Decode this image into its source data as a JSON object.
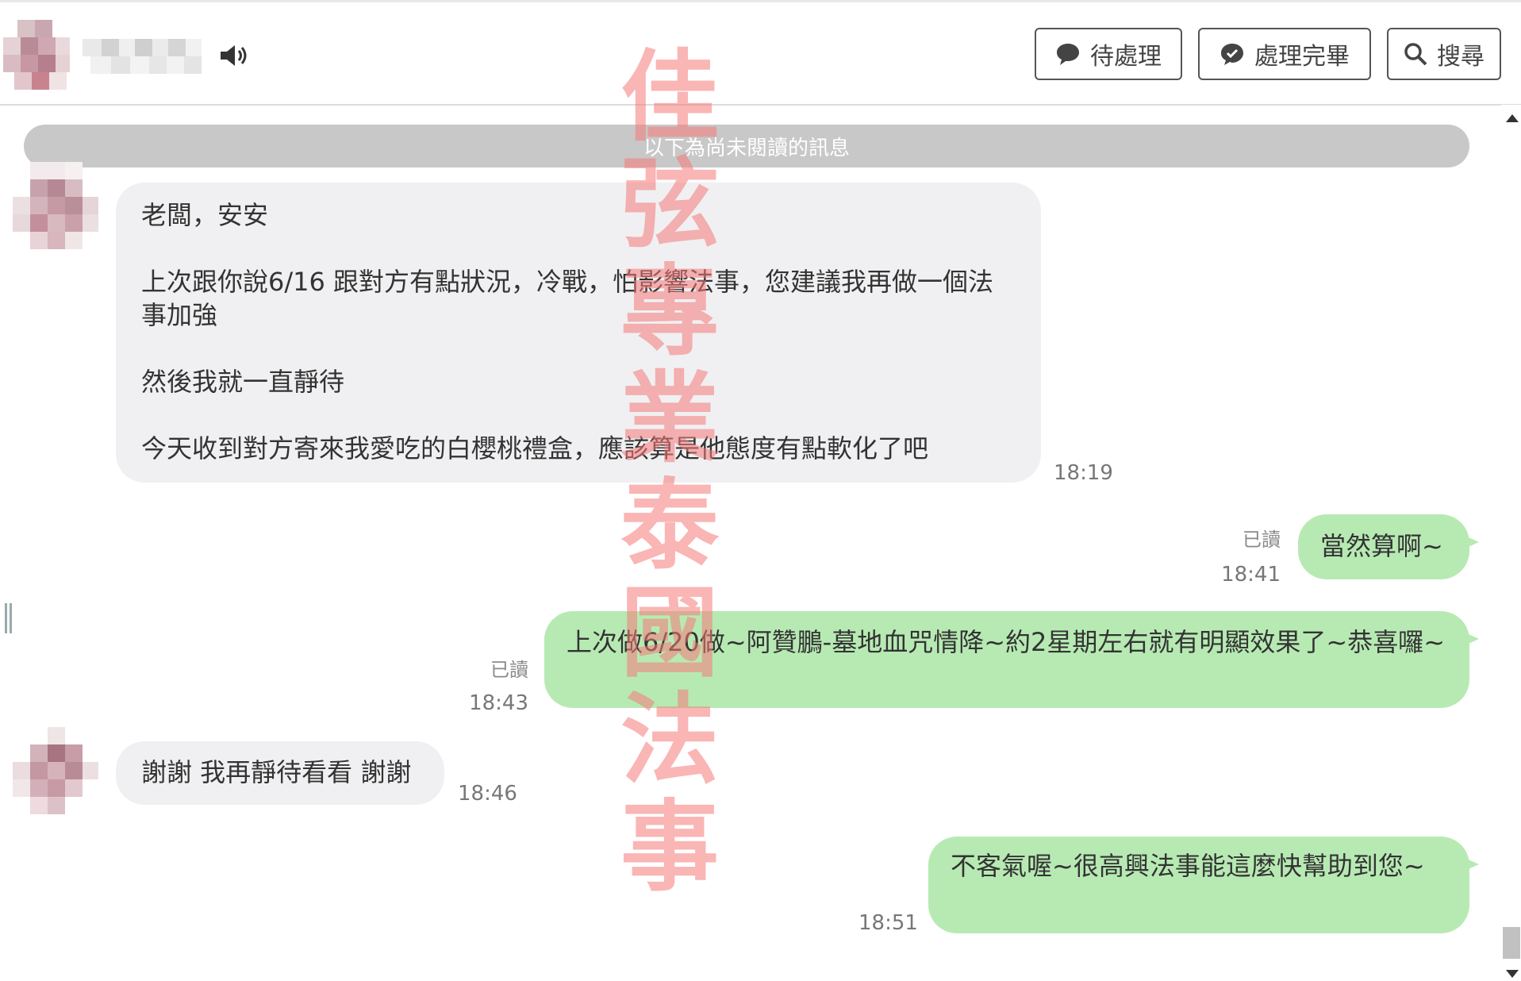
{
  "header": {
    "buttons": {
      "pending": "待處理",
      "done": "處理完畢",
      "search": "搜尋"
    },
    "icons": [
      "speaker-icon",
      "chat-bubble-icon",
      "chat-check-icon",
      "search-icon"
    ]
  },
  "unread_banner": "以下為尚未閱讀的訊息",
  "watermark": [
    "佳",
    "弦",
    "專",
    "業",
    "泰",
    "國",
    "法",
    "事"
  ],
  "messages": [
    {
      "direction": "in",
      "text": "老闆，安安\n\n上次跟你說6/16 跟對方有點狀況，冷戰，怕影響法事，您建議我再做一個法事加強\n\n然後我就一直靜待\n\n今天收到對方寄來我愛吃的白櫻桃禮盒，應該算是他態度有點軟化了吧",
      "time": "18:19"
    },
    {
      "direction": "out",
      "text": "當然算啊~",
      "read": "已讀",
      "time": "18:41"
    },
    {
      "direction": "out",
      "text": "上次做6/20做~阿贊鵬-墓地血咒情降~約2星期左右就有明顯效果了~恭喜囉~",
      "read": "已讀",
      "time": "18:43"
    },
    {
      "direction": "in",
      "text": "謝謝 我再靜待看看 謝謝",
      "time": "18:46"
    },
    {
      "direction": "out",
      "text": "不客氣喔~很高興法事能這麼快幫助到您~",
      "time": "18:51"
    }
  ],
  "colors": {
    "incoming_bubble": "#f0f0f2",
    "outgoing_bubble": "#b7eab3",
    "unread_bar": "#c8c8c8",
    "watermark": "#f67878"
  }
}
